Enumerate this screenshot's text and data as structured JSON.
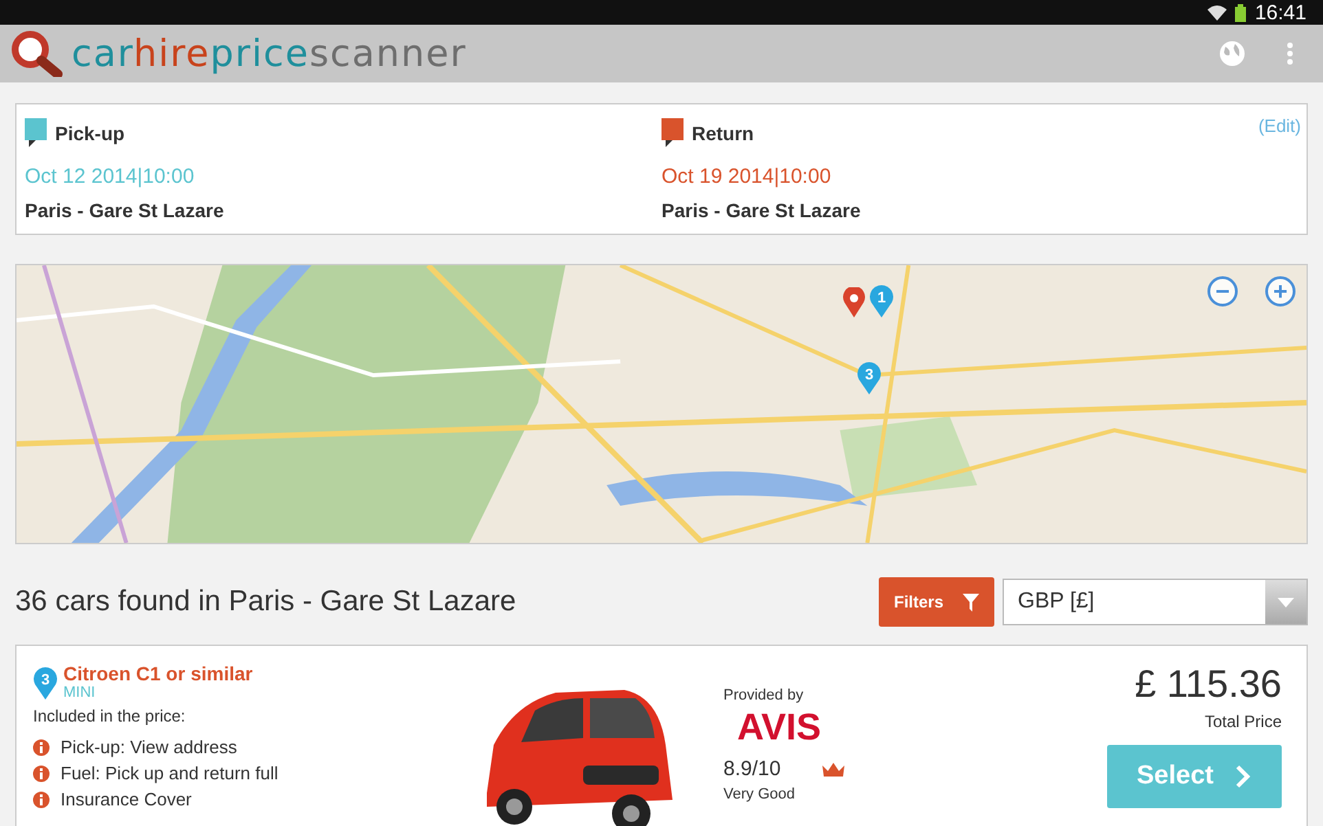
{
  "status_bar": {
    "time": "16:41"
  },
  "app_bar": {
    "logo": [
      {
        "text": "car",
        "color": "#1f8f9c"
      },
      {
        "text": "hire",
        "color": "#c8431c"
      },
      {
        "text": "price",
        "color": "#1f8f9c"
      },
      {
        "text": "scanner",
        "color": "#6e6e6e"
      }
    ]
  },
  "trip": {
    "pickup": {
      "label": "Pick-up",
      "datetime": "Oct 12 2014|10:00",
      "location": "Paris - Gare St Lazare"
    },
    "return": {
      "label": "Return",
      "datetime": "Oct 19 2014|10:00",
      "location": "Paris - Gare St Lazare"
    },
    "edit_link": "(Edit)"
  },
  "map": {
    "markers": [
      {
        "label": "1"
      },
      {
        "label": "3"
      }
    ],
    "zoom_out": "−",
    "zoom_in": "+"
  },
  "results": {
    "heading": "36 cars found in Paris - Gare St Lazare",
    "filters_button": "Filters",
    "currency": "GBP [£]"
  },
  "cars": [
    {
      "marker": "3",
      "name": "Citroen C1 or similar",
      "category": "MINI",
      "included_label": "Included in the price:",
      "features": [
        "Pick-up: View address",
        "Fuel: Pick up and return full",
        "Insurance Cover"
      ],
      "provided_by": "Provided by",
      "provider": "AVIS",
      "rating": "8.9/10",
      "rating_text": "Very Good",
      "price": "£ 115.36",
      "price_label": "Total Price",
      "select_button": "Select"
    }
  ]
}
